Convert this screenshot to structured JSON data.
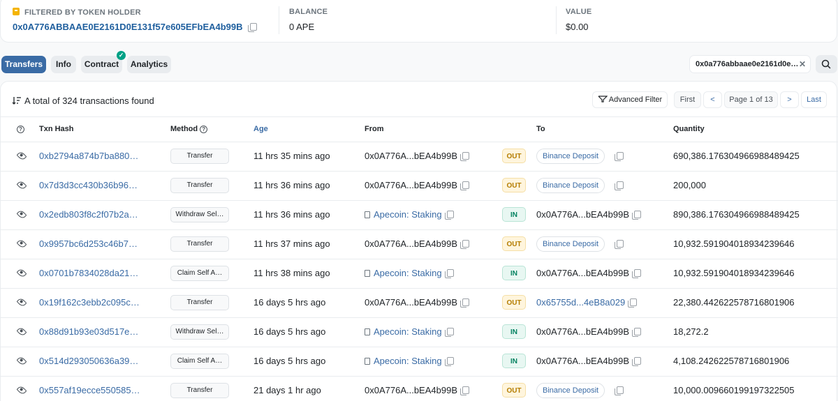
{
  "summary": {
    "holder_label": "FILTERED BY TOKEN HOLDER",
    "holder_address": "0x0A776ABBAAE0E2161D0E131f57e605EFbEA4b99B",
    "balance_label": "BALANCE",
    "balance_value": "0 APE",
    "value_label": "VALUE",
    "value_value": "$0.00"
  },
  "tabs": [
    "Transfers",
    "Info",
    "Contract",
    "Analytics"
  ],
  "active_tab": "Transfers",
  "filter_chip": "0x0a776abbaae0e2161d0e…",
  "toolbar": {
    "total_text": "A total of 324 transactions found",
    "advanced_filter": "Advanced Filter",
    "first": "First",
    "prev": "<",
    "page": "Page 1 of 13",
    "next": ">",
    "last": "Last"
  },
  "columns": [
    "Txn Hash",
    "Method",
    "Age",
    "From",
    "To",
    "Quantity"
  ],
  "rows": [
    {
      "hash": "0xb2794a874b7ba880…",
      "method": "Transfer",
      "age": "11 hrs 35 mins ago",
      "from": "0x0A776A...bEA4b99B",
      "from_type": "address",
      "dir": "OUT",
      "to": "Binance Deposit",
      "to_type": "tag",
      "qty": "690,386.176304966988489425"
    },
    {
      "hash": "0x7d3d3cc430b36b96…",
      "method": "Transfer",
      "age": "11 hrs 36 mins ago",
      "from": "0x0A776A...bEA4b99B",
      "from_type": "address",
      "dir": "OUT",
      "to": "Binance Deposit",
      "to_type": "tag",
      "qty": "200,000"
    },
    {
      "hash": "0x2edb803f8c2f07b2a…",
      "method": "Withdraw Sel…",
      "age": "11 hrs 36 mins ago",
      "from": "Apecoin: Staking",
      "from_type": "contract",
      "dir": "IN",
      "to": "0x0A776A...bEA4b99B",
      "to_type": "address",
      "qty": "890,386.176304966988489425"
    },
    {
      "hash": "0x9957bc6d253c46b7…",
      "method": "Transfer",
      "age": "11 hrs 37 mins ago",
      "from": "0x0A776A...bEA4b99B",
      "from_type": "address",
      "dir": "OUT",
      "to": "Binance Deposit",
      "to_type": "tag",
      "qty": "10,932.591904018934239646"
    },
    {
      "hash": "0x0701b7834028da21…",
      "method": "Claim Self A…",
      "age": "11 hrs 38 mins ago",
      "from": "Apecoin: Staking",
      "from_type": "contract",
      "dir": "IN",
      "to": "0x0A776A...bEA4b99B",
      "to_type": "address",
      "qty": "10,932.591904018934239646"
    },
    {
      "hash": "0x19f162c3ebb2c095c…",
      "method": "Transfer",
      "age": "16 days 5 hrs ago",
      "from": "0x0A776A...bEA4b99B",
      "from_type": "address",
      "dir": "OUT",
      "to": "0x65755d...4eB8a029",
      "to_type": "link",
      "qty": "22,380.442622578716801906"
    },
    {
      "hash": "0x88d91b93e03d517e…",
      "method": "Withdraw Sel…",
      "age": "16 days 5 hrs ago",
      "from": "Apecoin: Staking",
      "from_type": "contract",
      "dir": "IN",
      "to": "0x0A776A...bEA4b99B",
      "to_type": "address",
      "qty": "18,272.2"
    },
    {
      "hash": "0x514d293050636a39…",
      "method": "Claim Self A…",
      "age": "16 days 5 hrs ago",
      "from": "Apecoin: Staking",
      "from_type": "contract",
      "dir": "IN",
      "to": "0x0A776A...bEA4b99B",
      "to_type": "address",
      "qty": "4,108.242622578716801906"
    },
    {
      "hash": "0x557af19ecce550585…",
      "method": "Transfer",
      "age": "21 days 1 hr ago",
      "from": "0x0A776A...bEA4b99B",
      "from_type": "address",
      "dir": "OUT",
      "to": "Binance Deposit",
      "to_type": "tag",
      "qty": "10,000.009660199197322505"
    }
  ],
  "colors": {
    "accent": "#3a6ba5",
    "out_badge": "#b47d00",
    "in_badge": "#00805f",
    "verified": "#00a186"
  },
  "icons": {
    "lock": "lock-icon",
    "copy": "copy-icon",
    "eye": "eye-icon",
    "filter": "filter-icon",
    "sort": "sort-icon",
    "search": "search-icon",
    "close": "close-icon",
    "check": "check-icon",
    "document": "document-icon"
  }
}
